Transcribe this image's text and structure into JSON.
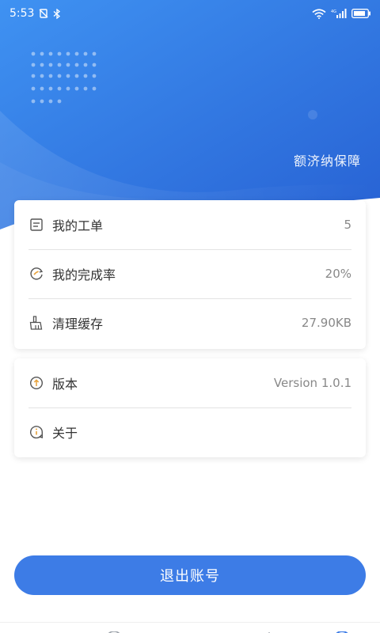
{
  "status_bar": {
    "time": "5:53",
    "icons": [
      "silent-icon",
      "bluetooth-icon",
      "wifi-icon",
      "signal-icon",
      "battery-icon"
    ],
    "network_label": "4G"
  },
  "header": {
    "tagline": "额济纳保障",
    "gradient_start": "#3b8cf0",
    "gradient_end": "#2a66d6"
  },
  "cards": {
    "stats": [
      {
        "icon": "work-order-icon",
        "label": "我的工单",
        "value": "5"
      },
      {
        "icon": "completion-rate-icon",
        "label": "我的完成率",
        "value": "20%"
      },
      {
        "icon": "clear-cache-icon",
        "label": "清理缓存",
        "value": "27.90KB"
      }
    ],
    "info": [
      {
        "icon": "version-icon",
        "label": "版本",
        "value": "Version 1.0.1"
      },
      {
        "icon": "about-icon",
        "label": "关于",
        "value": ""
      }
    ]
  },
  "logout": {
    "label": "退出账号",
    "color": "#3d7ce6"
  },
  "bottom_nav": {
    "items": [
      {
        "icon": "home-tab-icon"
      },
      {
        "icon": "clock-tab-icon"
      },
      {
        "icon": "location-tab-icon"
      },
      {
        "icon": "star-tab-icon"
      },
      {
        "icon": "profile-tab-icon"
      }
    ]
  }
}
